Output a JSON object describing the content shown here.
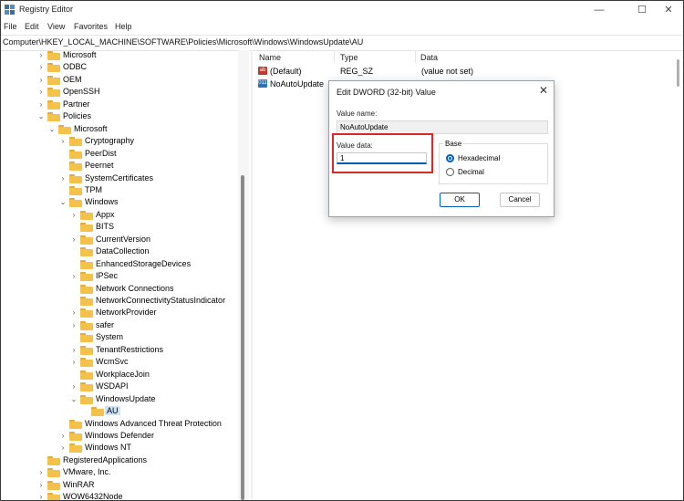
{
  "window": {
    "title": "Registry Editor",
    "minimize": "—",
    "maximize": "☐",
    "close": "✕"
  },
  "menu": [
    "File",
    "Edit",
    "View",
    "Favorites",
    "Help"
  ],
  "address": "Computer\\HKEY_LOCAL_MACHINE\\SOFTWARE\\Policies\\Microsoft\\Windows\\WindowsUpdate\\AU",
  "tree": [
    {
      "label": "Microsoft",
      "level": 0,
      "chevron": "right"
    },
    {
      "label": "ODBC",
      "level": 0,
      "chevron": "right"
    },
    {
      "label": "OEM",
      "level": 0,
      "chevron": "right"
    },
    {
      "label": "OpenSSH",
      "level": 0,
      "chevron": "right"
    },
    {
      "label": "Partner",
      "level": 0,
      "chevron": "right"
    },
    {
      "label": "Policies",
      "level": 0,
      "chevron": "down"
    },
    {
      "label": "Microsoft",
      "level": 1,
      "chevron": "down"
    },
    {
      "label": "Cryptography",
      "level": 2,
      "chevron": "right"
    },
    {
      "label": "PeerDist",
      "level": 2,
      "chevron": ""
    },
    {
      "label": "Peernet",
      "level": 2,
      "chevron": ""
    },
    {
      "label": "SystemCertificates",
      "level": 2,
      "chevron": "right"
    },
    {
      "label": "TPM",
      "level": 2,
      "chevron": ""
    },
    {
      "label": "Windows",
      "level": 2,
      "chevron": "down"
    },
    {
      "label": "Appx",
      "level": 3,
      "chevron": "right"
    },
    {
      "label": "BITS",
      "level": 3,
      "chevron": ""
    },
    {
      "label": "CurrentVersion",
      "level": 3,
      "chevron": "right"
    },
    {
      "label": "DataCollection",
      "level": 3,
      "chevron": ""
    },
    {
      "label": "EnhancedStorageDevices",
      "level": 3,
      "chevron": ""
    },
    {
      "label": "IPSec",
      "level": 3,
      "chevron": "right"
    },
    {
      "label": "Network Connections",
      "level": 3,
      "chevron": ""
    },
    {
      "label": "NetworkConnectivityStatusIndicator",
      "level": 3,
      "chevron": ""
    },
    {
      "label": "NetworkProvider",
      "level": 3,
      "chevron": "right"
    },
    {
      "label": "safer",
      "level": 3,
      "chevron": "right"
    },
    {
      "label": "System",
      "level": 3,
      "chevron": ""
    },
    {
      "label": "TenantRestrictions",
      "level": 3,
      "chevron": "right"
    },
    {
      "label": "WcmSvc",
      "level": 3,
      "chevron": "right"
    },
    {
      "label": "WorkplaceJoin",
      "level": 3,
      "chevron": ""
    },
    {
      "label": "WSDAPI",
      "level": 3,
      "chevron": "right"
    },
    {
      "label": "WindowsUpdate",
      "level": 3,
      "chevron": "down"
    },
    {
      "label": "AU",
      "level": 4,
      "chevron": "",
      "selected": true
    },
    {
      "label": "Windows Advanced Threat Protection",
      "level": 2,
      "chevron": ""
    },
    {
      "label": "Windows Defender",
      "level": 2,
      "chevron": "right"
    },
    {
      "label": "Windows NT",
      "level": 2,
      "chevron": "right"
    },
    {
      "label": "RegisteredApplications",
      "level": 0,
      "chevron": ""
    },
    {
      "label": "VMware, Inc.",
      "level": 0,
      "chevron": "right"
    },
    {
      "label": "WinRAR",
      "level": 0,
      "chevron": "right"
    },
    {
      "label": "WOW6432Node",
      "level": 0,
      "chevron": "right"
    }
  ],
  "columns": {
    "name": "Name",
    "type": "Type",
    "data": "Data"
  },
  "values": [
    {
      "name": "(Default)",
      "type": "REG_SZ",
      "data": "(value not set)",
      "icon": "ab",
      "icon_color": "#c0392b"
    },
    {
      "name": "NoAutoUpdate",
      "type": "",
      "data": "",
      "icon": "011",
      "icon_color": "#2f6fb3"
    }
  ],
  "dialog": {
    "title": "Edit DWORD (32-bit) Value",
    "close": "✕",
    "value_name_label": "Value name:",
    "value_name": "NoAutoUpdate",
    "value_data_label": "Value data:",
    "value_data": "1",
    "base_label": "Base",
    "hex_label": "Hexadecimal",
    "dec_label": "Decimal",
    "base_selected": "Hexadecimal",
    "ok": "OK",
    "cancel": "Cancel"
  },
  "colors": {
    "folder": "#f4c24a",
    "accent": "#005fb8",
    "highlight": "#d42a2a"
  }
}
